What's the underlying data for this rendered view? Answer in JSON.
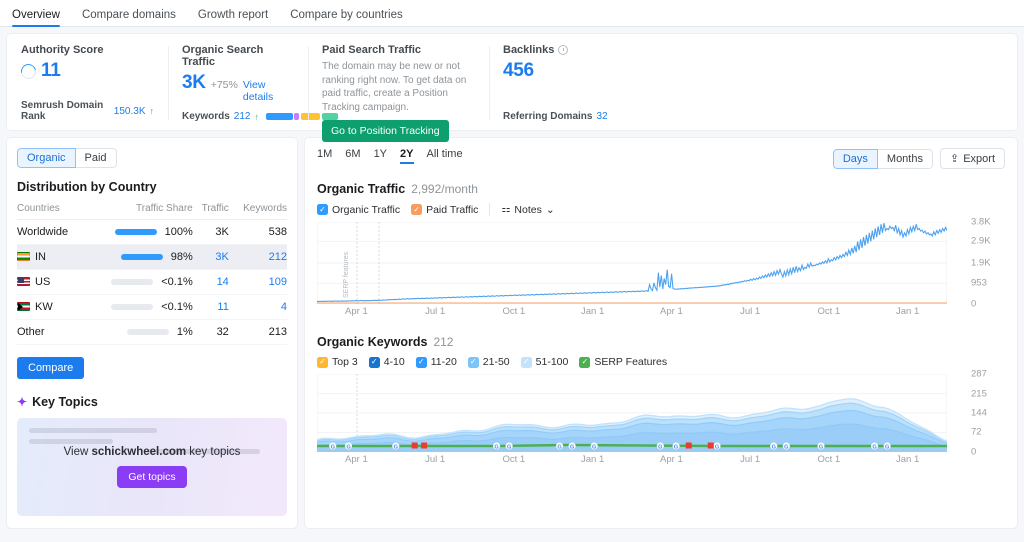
{
  "tabs": [
    {
      "label": "Overview",
      "active": true
    },
    {
      "label": "Compare domains",
      "active": false
    },
    {
      "label": "Growth report",
      "active": false
    },
    {
      "label": "Compare by countries",
      "active": false
    }
  ],
  "cards": {
    "authority": {
      "title": "Authority Score",
      "value": "11",
      "foot_label": "Semrush Domain Rank",
      "foot_value": "150.3K",
      "foot_arrow": "↑"
    },
    "organic_traffic": {
      "title": "Organic Search Traffic",
      "value": "3K",
      "delta": "+75%",
      "link": "View details",
      "foot_label": "Keywords",
      "foot_value": "212",
      "foot_arrow": "↑",
      "bar_segments": [
        {
          "color": "#2f9bff",
          "width": 28
        },
        {
          "color": "#c77dff",
          "width": 5
        },
        {
          "color": "#ffc233",
          "width": 20
        },
        {
          "color": "#4dd4a0",
          "width": 17
        }
      ]
    },
    "paid_traffic": {
      "title": "Paid Search Traffic",
      "description": "The domain may be new or not ranking right now. To get data on paid traffic, create a Position Tracking campaign.",
      "button": "Go to Position Tracking"
    },
    "backlinks": {
      "title": "Backlinks",
      "icon": "clock-icon",
      "value": "456",
      "foot_label": "Referring Domains",
      "foot_value": "32"
    }
  },
  "sidebar": {
    "toggle": {
      "options": [
        "Organic",
        "Paid"
      ],
      "selected": "Organic"
    },
    "section_title": "Distribution by Country",
    "table": {
      "headers": [
        "Countries",
        "Traffic Share",
        "Traffic",
        "Keywords"
      ],
      "rows": [
        {
          "country": "Worldwide",
          "flag": null,
          "share": "100%",
          "bar": 100,
          "traffic": "3K",
          "keywords": "538",
          "highlight": false,
          "linked": false
        },
        {
          "country": "IN",
          "flag": "flag-in",
          "share": "98%",
          "bar": 98,
          "traffic": "3K",
          "keywords": "212",
          "highlight": true,
          "linked": true
        },
        {
          "country": "US",
          "flag": "flag-us",
          "share": "<0.1%",
          "bar": 0,
          "traffic": "14",
          "keywords": "109",
          "highlight": false,
          "linked": true
        },
        {
          "country": "KW",
          "flag": "flag-kw",
          "share": "<0.1%",
          "bar": 0,
          "traffic": "11",
          "keywords": "4",
          "highlight": false,
          "linked": true
        },
        {
          "country": "Other",
          "flag": null,
          "share": "1%",
          "bar": 0,
          "traffic": "32",
          "keywords": "213",
          "highlight": false,
          "linked": false
        }
      ]
    },
    "compare_button": "Compare",
    "key_topics": {
      "title": "Key Topics",
      "promo_prefix": "View ",
      "promo_domain": "schickwheel.com",
      "promo_suffix": " key topics",
      "button": "Get topics"
    }
  },
  "chart_panel": {
    "ranges": [
      {
        "label": "1M",
        "active": false
      },
      {
        "label": "6M",
        "active": false
      },
      {
        "label": "1Y",
        "active": false
      },
      {
        "label": "2Y",
        "active": true
      },
      {
        "label": "All time",
        "active": false
      }
    ],
    "granularity": {
      "options": [
        "Days",
        "Months"
      ],
      "selected": "Days"
    },
    "export_label": "Export",
    "notes_label": "Notes"
  },
  "chart_data": [
    {
      "type": "line",
      "title": "Organic Traffic",
      "subtitle": "2,992/month",
      "xlabel": "",
      "ylabel": "",
      "ylim": [
        0,
        3800
      ],
      "ytick_labels": [
        "3.8K",
        "2.9K",
        "1.9K",
        "953",
        "0"
      ],
      "ytick_values": [
        3800,
        2900,
        1900,
        953,
        0
      ],
      "xtick_labels": [
        "Apr 1",
        "Jul 1",
        "Oct 1",
        "Jan 1",
        "Apr 1",
        "Jul 1",
        "Oct 1",
        "Jan 1"
      ],
      "grid": true,
      "annotation": "SERP features",
      "legend_position": "top",
      "series": [
        {
          "name": "Organic Traffic",
          "color": "#4da2f0",
          "checked": true,
          "values": [
            120,
            110,
            130,
            118,
            125,
            132,
            120,
            128,
            140,
            122,
            135,
            128,
            130,
            142,
            125,
            138,
            130,
            145,
            132,
            140,
            128,
            150,
            138,
            142,
            155,
            140,
            148,
            160,
            145,
            152,
            165,
            150,
            158,
            145,
            162,
            150,
            168,
            155,
            172,
            160,
            175,
            162,
            180,
            168,
            172,
            190,
            178,
            185,
            200,
            190,
            210,
            195,
            205,
            220,
            200,
            215,
            230,
            210,
            225,
            240,
            222,
            235,
            250,
            230,
            245,
            238,
            255,
            240,
            250,
            262,
            245,
            258,
            268,
            250,
            262,
            275,
            258,
            270,
            282,
            265,
            278,
            288,
            270,
            285,
            295,
            278,
            290,
            300,
            285,
            295,
            310,
            290,
            305,
            318,
            298,
            310,
            325,
            305,
            318,
            330,
            312,
            325,
            338,
            318,
            330,
            345,
            325,
            338,
            352,
            330,
            345,
            360,
            338,
            350,
            368,
            345,
            358,
            375,
            350,
            365,
            380,
            358,
            372,
            388,
            362,
            378,
            395,
            370,
            385,
            400,
            378,
            392,
            408,
            385,
            398,
            415,
            390,
            405,
            420,
            398,
            412,
            428,
            405,
            418,
            435,
            410,
            425,
            440,
            418,
            432,
            448,
            425,
            438,
            455,
            430,
            445,
            460,
            438,
            452,
            468,
            445,
            458,
            475,
            450,
            465,
            480,
            458,
            472,
            488,
            465,
            478,
            495,
            470,
            485,
            500,
            478,
            492,
            508,
            485,
            498,
            515,
            490,
            505,
            520,
            498,
            512,
            528,
            505,
            518,
            535,
            510,
            525,
            540,
            518,
            532,
            548,
            525,
            538,
            555,
            530,
            545,
            560,
            538,
            552,
            568,
            545,
            558,
            575,
            550,
            565,
            580,
            558,
            572,
            588,
            565,
            578,
            595,
            570,
            585,
            600,
            578,
            592,
            608,
            585,
            598,
            615,
            590,
            900,
            700,
            620,
            980,
            760,
            640,
            1450,
            780,
            1320,
            700,
            1180,
            900,
            1600,
            820,
            760,
            1400,
            720,
            690,
            680,
            700,
            690,
            710,
            700,
            720,
            710,
            730,
            720,
            740,
            730,
            750,
            740,
            760,
            750,
            770,
            760,
            780,
            770,
            790,
            780,
            800,
            790,
            810,
            800,
            820,
            810,
            830,
            820,
            850,
            840,
            870,
            860,
            900,
            880,
            920,
            900,
            950,
            930,
            980,
            960,
            1000,
            980,
            1020,
            1000,
            1050,
            1030,
            1080,
            1050,
            1100,
            1080,
            1150,
            1100,
            1180,
            1120,
            1200,
            1150,
            1250,
            1180,
            1300,
            1220,
            1350,
            1250,
            1400,
            1280,
            1450,
            1300,
            1500,
            1330,
            1550,
            1380,
            1600,
            1400,
            1250,
            1500,
            1300,
            1580,
            1350,
            1620,
            1400,
            1700,
            1450,
            1750,
            1500,
            1680,
            1550,
            1800,
            1600,
            1700,
            1650,
            1850,
            1700,
            1900,
            1750,
            1800,
            1780,
            1850,
            1820,
            1900,
            1850,
            1950,
            1880,
            2000,
            1900,
            2100,
            1950,
            2050,
            2000,
            2150,
            2050,
            2200,
            2100,
            2250,
            2150,
            2300,
            2200,
            2400,
            2250,
            2500,
            2300,
            2600,
            2350,
            2700,
            2400,
            2900,
            2500,
            3000,
            2600,
            3100,
            2700,
            3200,
            2800,
            3300,
            2900,
            3400,
            3000,
            3500,
            3100,
            3600,
            3200,
            3700,
            3300,
            3750,
            3400,
            3500,
            3450,
            3600,
            3500,
            3550,
            3400,
            3650,
            3300,
            3500,
            3200,
            3400,
            3100,
            3300,
            3150,
            3450,
            3250,
            3550,
            3350,
            3600,
            3400,
            3700,
            3450,
            3500,
            3380,
            3420,
            3300,
            3380,
            3250,
            3300,
            3200,
            3250,
            3150,
            3350,
            3200,
            3400,
            3280,
            3450,
            3320,
            3500,
            3380,
            3550,
            3400
          ]
        },
        {
          "name": "Paid Traffic",
          "color": "#f79d62",
          "checked": true,
          "values": [
            0,
            0,
            0,
            0,
            0,
            0,
            0,
            0,
            0,
            0,
            0,
            0
          ]
        }
      ]
    },
    {
      "type": "area",
      "title": "Organic Keywords",
      "subtitle": "212",
      "xlabel": "",
      "ylabel": "",
      "ylim": [
        0,
        287
      ],
      "ytick_labels": [
        "287",
        "215",
        "144",
        "72",
        "0"
      ],
      "ytick_values": [
        287,
        215,
        144,
        72,
        0
      ],
      "xtick_labels": [
        "Apr 1",
        "Jul 1",
        "Oct 1",
        "Jan 1",
        "Apr 1",
        "Jul 1",
        "Oct 1",
        "Jan 1"
      ],
      "grid": true,
      "stacked": true,
      "legend_position": "top",
      "series": [
        {
          "name": "Top 3",
          "color": "#ffb733",
          "checked": true
        },
        {
          "name": "4-10",
          "color": "#1675d1",
          "checked": true
        },
        {
          "name": "11-20",
          "color": "#2f9bff",
          "checked": true
        },
        {
          "name": "21-50",
          "color": "#7cc4f8",
          "checked": true
        },
        {
          "name": "51-100",
          "color": "#c3e2fb",
          "checked": true
        },
        {
          "name": "SERP Features",
          "color": "#4caf50",
          "checked": true
        }
      ],
      "markers": {
        "google_icon_label": "G",
        "google_positions": [
          2.5,
          5.0,
          12.5,
          28.5,
          30.5,
          38.5,
          40.5,
          44.0,
          54.5,
          57.0,
          63.5,
          72.5,
          74.5,
          80.0,
          88.5,
          90.5
        ],
        "flag_positions": [
          15.5,
          17.0,
          59.0,
          62.5
        ],
        "flag_color": "#ef3b2d"
      }
    }
  ]
}
